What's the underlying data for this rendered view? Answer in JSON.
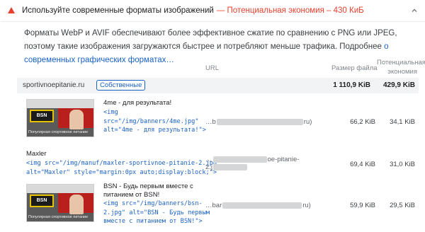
{
  "audit": {
    "title": "Используйте современные форматы изображений",
    "savings": "— Потенциальная экономия – 430 КиБ",
    "status_color": "#e8402f",
    "description": "Форматы WebP и AVIF обеспечивают более эффективное сжатие по сравнению с PNG или JPEG, поэтому такие изображения загружаются быстрее и потребляют меньше трафика. Подробнее ",
    "learn_more_link": "о современных графических форматах…"
  },
  "table": {
    "headers": {
      "url": "URL",
      "size": "Размер файла",
      "savings_line1": "Потенциальная",
      "savings_line2": "экономия"
    },
    "group": {
      "name": "sportivnoepitanie.ru",
      "badge": "Собственные",
      "size": "1 110,9 KiB",
      "savings": "429,9 KiB"
    },
    "rows": [
      {
        "label": "4me - для результата!",
        "code": "<img\nsrc=\"/img/banners/4me.jpg\"\nalt=\"4me - для результата!\">",
        "url_prefix": "…b",
        "url_suffix": "ru)",
        "size": "66,2 KiB",
        "savings": "34,1 KiB",
        "thumb_logo": "BSN",
        "thumb_caption": "Популярная спортивное питание"
      },
      {
        "label": "Maxler",
        "code": "<img src=\"/img/manuf/maxler-sportivnoe-pitanie-2.jpg\"\nalt=\"Maxler\" style=\"margin:0px auto;display:block;\">",
        "url_prefix": "…",
        "url_mid": "oe-pitanie-",
        "url_line2": "2.j",
        "size": "69,4 KiB",
        "savings": "31,0 KiB"
      },
      {
        "label": "BSN - Будь первым вместе с\nпитанием от BSN!",
        "code": "<img src=\"/img/banners/bsn-\n2.jpg\" alt=\"BSN - Будь первым\nвместе с питанием от BSN!\">",
        "url_prefix": "…bar",
        "url_suffix": "ru)",
        "size": "59,9 KiB",
        "savings": "29,5 KiB",
        "thumb_logo": "BSN",
        "thumb_caption": "Популярная спортивное питание"
      }
    ]
  }
}
